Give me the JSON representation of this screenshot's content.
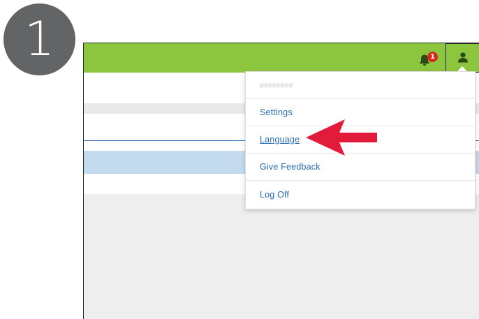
{
  "step": {
    "number": "1"
  },
  "topbar": {
    "accent_color": "#8cc63f",
    "notifications": {
      "icon": "bell-icon",
      "count": "1"
    },
    "user_menu": {
      "icon": "user-icon"
    }
  },
  "dropdown": {
    "username": "xxxxxxxx",
    "items": [
      {
        "label": "Settings"
      },
      {
        "label": "Language",
        "highlighted": true
      },
      {
        "label": "Give Feedback"
      },
      {
        "label": "Log Off"
      }
    ],
    "link_color": "#2a6db0"
  },
  "annotation": {
    "icon": "arrow-left-icon",
    "color": "#e31b3b"
  }
}
